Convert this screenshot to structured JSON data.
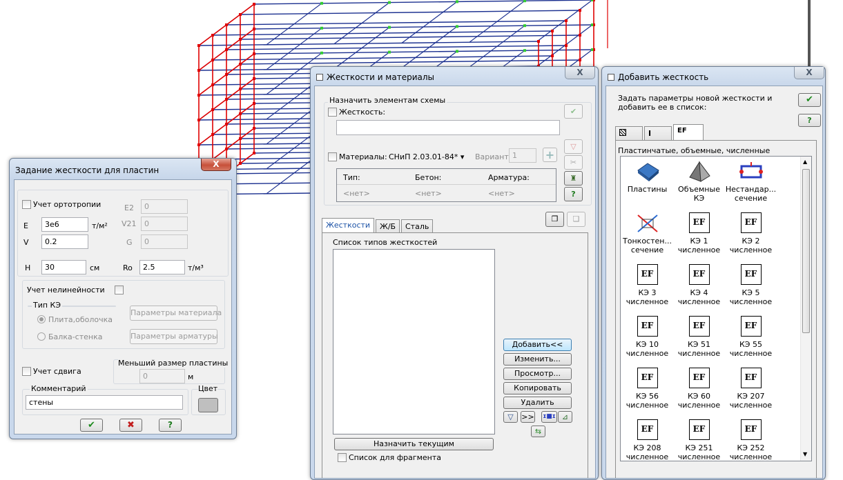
{
  "colors": {
    "frame_red": "#e00000",
    "frame_blue": "#1a2f8f",
    "node_green": "#33cc33",
    "accent": "#1b52a6"
  },
  "plate": {
    "title": "Задание жесткости для пластин",
    "close": "X",
    "ortho_label": "Учет ортотропии",
    "e_label": "E",
    "e_value": "3e6",
    "e_unit": "т/м²",
    "v_label": "V",
    "v_value": "0.2",
    "e2_label": "E2",
    "e2_value": "0",
    "v21_label": "V21",
    "v21_value": "0",
    "g_label": "G",
    "g_value": "0",
    "h_label": "H",
    "h_value": "30",
    "h_unit": "см",
    "ro_label": "Ro",
    "ro_value": "2.5",
    "ro_unit": "т/м³",
    "nonlin_label": "Учет нелинейности",
    "fe_type_label": "Тип КЭ",
    "radio1": "Плита,оболочка",
    "radio2": "Балка-стенка",
    "mat_params": "Параметры материала",
    "rebar_params": "Параметры арматуры",
    "shear_label": "Учет сдвига",
    "min_size_label": "Меньший размер пластины",
    "min_size_value": "0",
    "min_size_unit": "м",
    "comment_label": "Комментарий",
    "comment_value": "стены",
    "color_label": "Цвет",
    "ok": "✔",
    "cancel": "✖",
    "help": "?"
  },
  "stiff": {
    "title": "Жесткости и материалы",
    "close": "X",
    "assign_group": "Назначить элементам схемы",
    "stiffness_chk": "Жесткость:",
    "materials_chk": "Материалы:",
    "snip": "СНиП 2.03.01-84*",
    "variant_label": "Вариант",
    "variant_value": "1",
    "col_type": "Тип:",
    "col_concrete": "Бетон:",
    "col_rebar": "Арматура:",
    "none1": "<нет>",
    "none2": "<нет>",
    "none3": "<нет>",
    "tab1": "Жесткости",
    "tab2": "Ж/Б",
    "tab3": "Сталь",
    "list_label": "Список типов жесткостей",
    "add": "Добавить<<",
    "edit": "Изменить...",
    "view": "Просмотр...",
    "copy": "Копировать",
    "delete": "Удалить",
    "nav": ">>",
    "assign_current": "Назначить текущим",
    "fragment_chk": "Список для фрагмента",
    "help": "?"
  },
  "add": {
    "title": "Добавить жесткость",
    "close": "X",
    "desc": "Задать параметры новой жесткости и добавить ее в список:",
    "tab_main": "EF",
    "category": "Пластинчатые, объемные, численные",
    "ef": "EF",
    "items": [
      {
        "l1": "Пластины",
        "l2": ""
      },
      {
        "l1": "Объемные",
        "l2": "КЭ"
      },
      {
        "l1": "Нестандар...",
        "l2": "сечение"
      },
      {
        "l1": "Тонкостен...",
        "l2": "сечение"
      },
      {
        "l1": "КЭ 1",
        "l2": "численное"
      },
      {
        "l1": "КЭ 2",
        "l2": "численное"
      },
      {
        "l1": "КЭ 3",
        "l2": "численное"
      },
      {
        "l1": "КЭ 4",
        "l2": "численное"
      },
      {
        "l1": "КЭ 5",
        "l2": "численное"
      },
      {
        "l1": "КЭ 10",
        "l2": "численное"
      },
      {
        "l1": "КЭ 51",
        "l2": "численное"
      },
      {
        "l1": "КЭ 55",
        "l2": "численное"
      },
      {
        "l1": "КЭ 56",
        "l2": "численное"
      },
      {
        "l1": "КЭ 60",
        "l2": "численное"
      },
      {
        "l1": "КЭ 207",
        "l2": "численное"
      },
      {
        "l1": "КЭ 208",
        "l2": "численное"
      },
      {
        "l1": "КЭ 251",
        "l2": "численное"
      },
      {
        "l1": "КЭ 252",
        "l2": "численное"
      }
    ],
    "help": "?"
  }
}
